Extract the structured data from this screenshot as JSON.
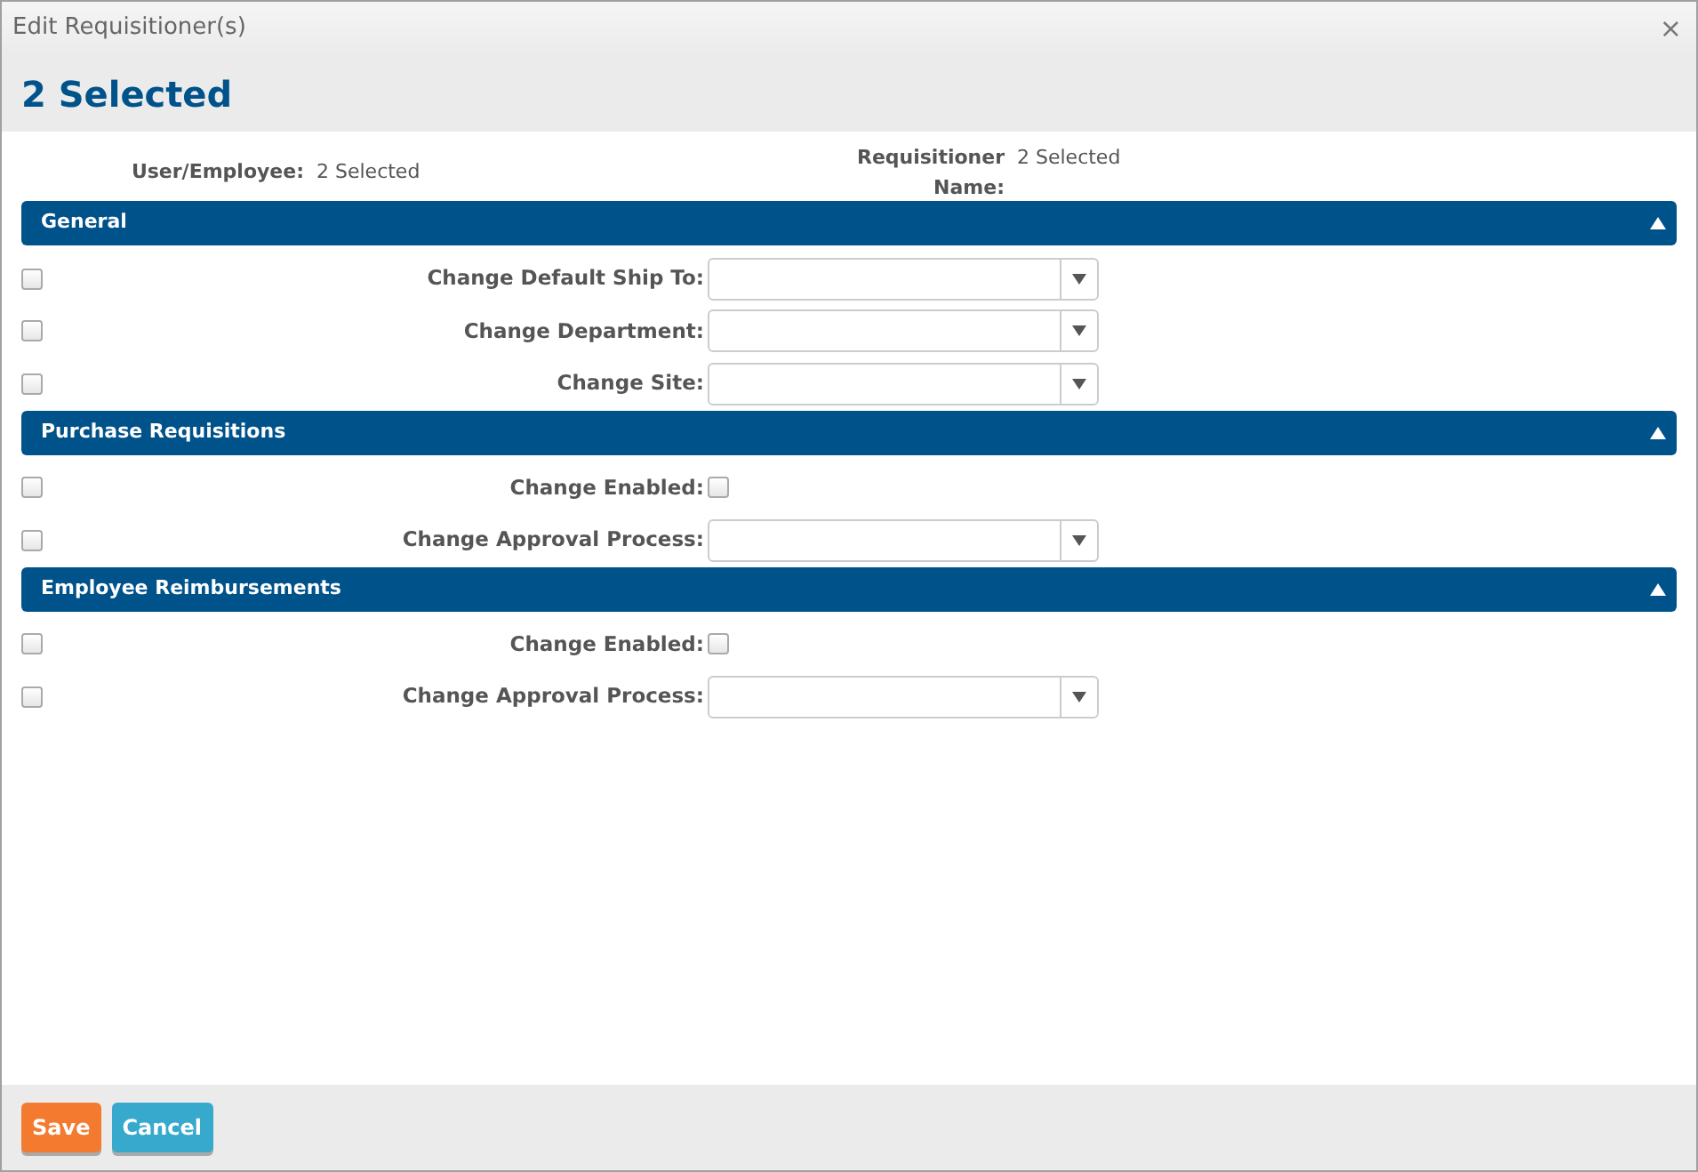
{
  "window": {
    "title": "Edit Requisitioner(s)",
    "close": "×"
  },
  "heading": "2 Selected",
  "summary": [
    {
      "label": "User/Employee:",
      "value": "2 Selected"
    },
    {
      "label": "Requisitioner Name:",
      "value": "2 Selected"
    }
  ],
  "sections": [
    {
      "title": "General",
      "expanded": true,
      "fields": [
        {
          "label": "Change Default Ship To:",
          "kind": "select",
          "checked": false
        },
        {
          "label": "Change Department:",
          "kind": "select",
          "checked": false
        },
        {
          "label": "Change Site:",
          "kind": "select",
          "checked": false
        }
      ]
    },
    {
      "title": "Purchase Requisitions",
      "expanded": true,
      "fields": [
        {
          "label": "Change Enabled:",
          "kind": "checkbox",
          "checked": false,
          "value_checked": false
        },
        {
          "label": "Change Approval Process:",
          "kind": "select",
          "checked": false
        }
      ]
    },
    {
      "title": "Employee Reimbursements",
      "expanded": true,
      "fields": [
        {
          "label": "Change Enabled:",
          "kind": "checkbox",
          "checked": false,
          "value_checked": false
        },
        {
          "label": "Change Approval Process:",
          "kind": "select",
          "checked": false
        }
      ]
    }
  ],
  "buttons": [
    {
      "label": "Save",
      "kind": "primary"
    },
    {
      "label": "Cancel",
      "kind": "secondary"
    }
  ]
}
